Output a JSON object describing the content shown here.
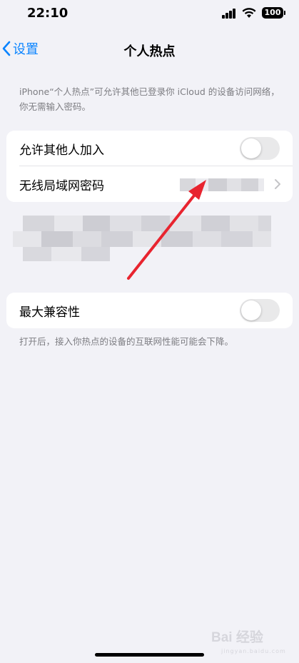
{
  "status_bar": {
    "time": "22:10",
    "battery": "100"
  },
  "nav": {
    "back_label": "设置",
    "title": "个人热点"
  },
  "description": "iPhone“个人热点”可允许其他已登录你 iCloud 的设备访问网络，你无需输入密码。",
  "settings": {
    "allow_others": {
      "label": "允许其他人加入",
      "enabled": false
    },
    "wifi_password": {
      "label": "无线局域网密码"
    }
  },
  "compatibility": {
    "label": "最大兼容性",
    "enabled": false,
    "footer": "打开后，接入你热点的设备的互联网性能可能会下降。"
  },
  "colors": {
    "accent": "#0a84ff",
    "background": "#f2f2f7",
    "arrow": "#e8242f"
  },
  "watermark": {
    "text": "Bai 经验",
    "sub": "jingyan.baidu.com"
  }
}
